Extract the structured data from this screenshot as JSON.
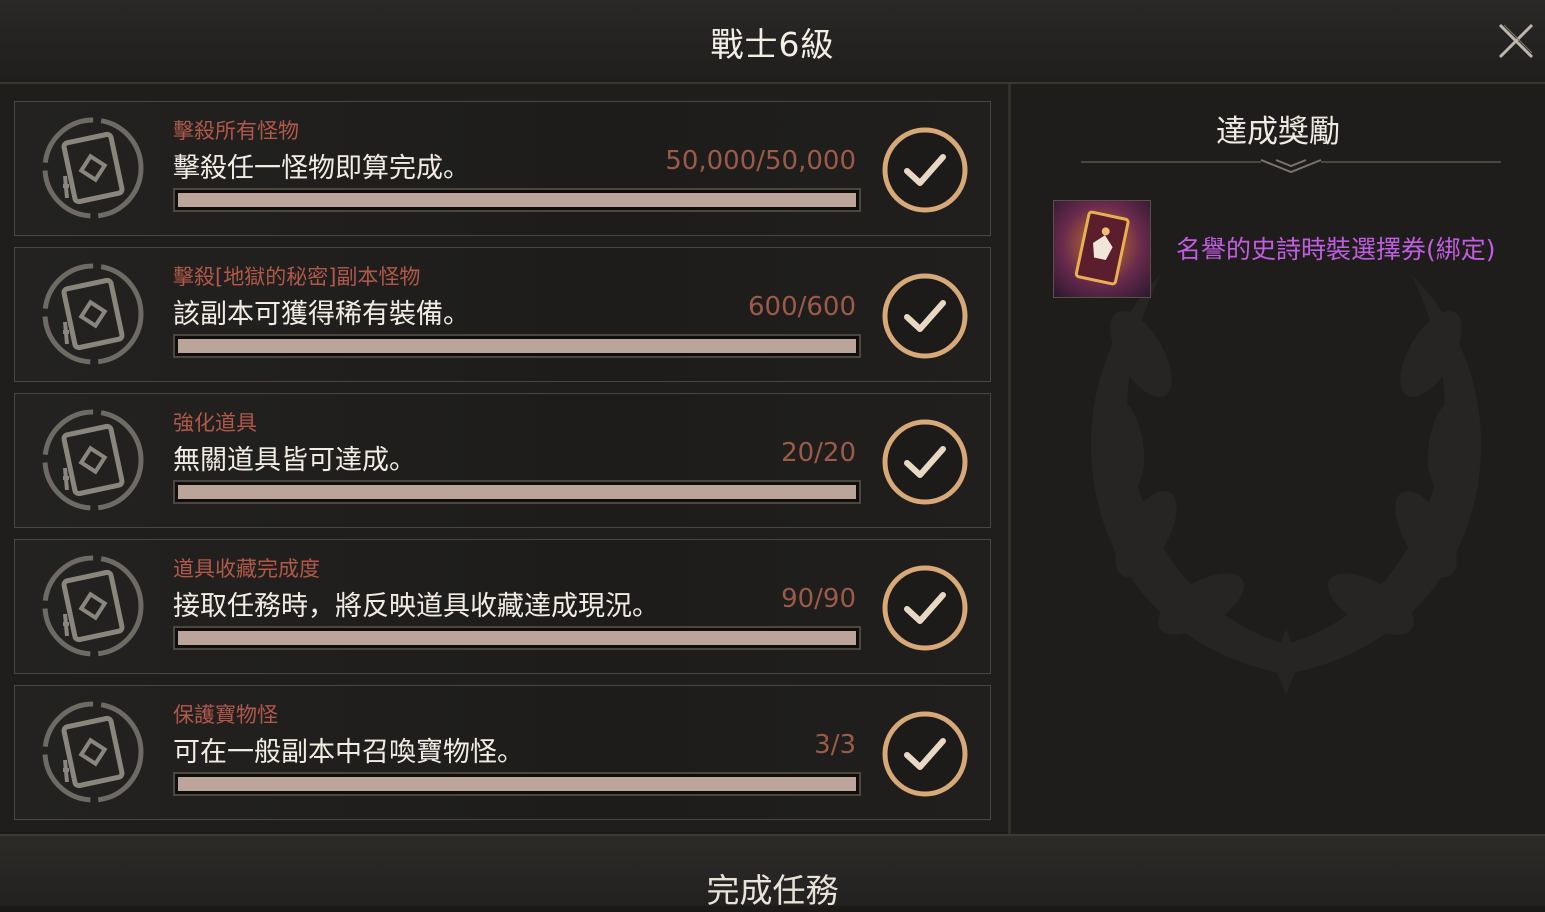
{
  "header": {
    "title": "戰士6級"
  },
  "quests": [
    {
      "category": "擊殺所有怪物",
      "description": "擊殺任一怪物即算完成。",
      "progress_text": "50,000/50,000",
      "progress": 1.0
    },
    {
      "category": "擊殺[地獄的秘密]副本怪物",
      "description": "該副本可獲得稀有裝備。",
      "progress_text": "600/600",
      "progress": 1.0
    },
    {
      "category": "強化道具",
      "description": "無關道具皆可達成。",
      "progress_text": "20/20",
      "progress": 1.0
    },
    {
      "category": "道具收藏完成度",
      "description": "接取任務時，將反映道具收藏達成現況。",
      "progress_text": "90/90",
      "progress": 1.0
    },
    {
      "category": "保護寶物怪",
      "description": "可在一般副本中召喚寶物怪。",
      "progress_text": "3/3",
      "progress": 1.0
    }
  ],
  "reward": {
    "title": "達成獎勵",
    "item_name": "名譽的史詩時裝選擇券(綁定)",
    "item_icon": "epic-costume-ticket-icon"
  },
  "footer": {
    "complete_label": "完成任務"
  },
  "colors": {
    "category": "#b0584a",
    "progress_text": "#9c5a49",
    "bar_fill": "#bba59a",
    "reward_name": "#c15ee0",
    "check_ring": "#d7a878"
  }
}
